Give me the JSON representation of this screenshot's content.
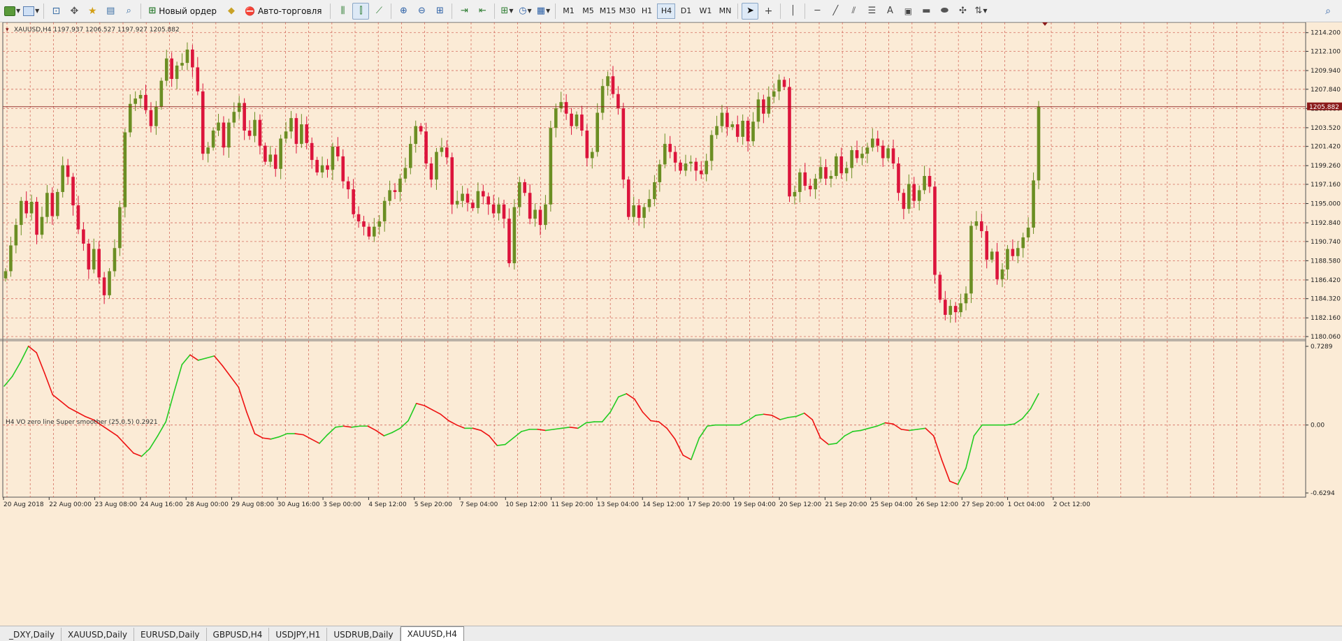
{
  "toolbar": {
    "new_order_label": "Новый ордер",
    "autotrade_label": "Авто-торговля",
    "timeframes": [
      {
        "label": "M1",
        "active": false
      },
      {
        "label": "M5",
        "active": false
      },
      {
        "label": "M15",
        "active": false
      },
      {
        "label": "M30",
        "active": false
      },
      {
        "label": "H1",
        "active": false
      },
      {
        "label": "H4",
        "active": true
      },
      {
        "label": "D1",
        "active": false
      },
      {
        "label": "W1",
        "active": false
      },
      {
        "label": "MN",
        "active": false
      }
    ]
  },
  "chart": {
    "info_line": "XAUUSD,H4  1197.937 1206.527 1197.927 1205.882",
    "current_price_label": "1205.882",
    "current_price": 1205.882,
    "indicator_label": "H4 VO zero line Super smoother (25,0.5) 0.2921",
    "price_ticks": [
      "1214.200",
      "1212.100",
      "1209.940",
      "1207.840",
      "1205.680",
      "1203.520",
      "1201.420",
      "1199.260",
      "1197.160",
      "1195.000",
      "1192.840",
      "1190.740",
      "1188.580",
      "1186.420",
      "1184.320",
      "1182.160",
      "1180.060"
    ],
    "indicator_ticks": [
      "0.7289",
      "0.00",
      "-0.6294"
    ],
    "time_labels": [
      "20 Aug 2018",
      "22 Aug 00:00",
      "23 Aug 08:00",
      "24 Aug 16:00",
      "28 Aug 00:00",
      "29 Aug 08:00",
      "30 Aug 16:00",
      "3 Sep 00:00",
      "4 Sep 12:00",
      "5 Sep 20:00",
      "7 Sep 04:00",
      "10 Sep 12:00",
      "11 Sep 20:00",
      "13 Sep 04:00",
      "14 Sep 12:00",
      "17 Sep 20:00",
      "19 Sep 04:00",
      "20 Sep 12:00",
      "21 Sep 20:00",
      "25 Sep 04:00",
      "26 Sep 12:00",
      "27 Sep 20:00",
      "1 Oct 04:00",
      "2 Oct 12:00"
    ],
    "colors": {
      "background": "#fbebd6",
      "grid": "#c8453a",
      "bull": "#6b8e23",
      "bear": "#dc143c",
      "indicator_up": "#22cc22",
      "indicator_down": "#ee1111",
      "price_tag": "#8b1a1a"
    }
  },
  "chart_data": {
    "type": "candlestick",
    "symbol": "XAUUSD",
    "timeframe": "H4",
    "ylim": [
      1180.06,
      1215.2
    ],
    "closes": [
      1187.4,
      1190.3,
      1192.6,
      1195.3,
      1193.9,
      1195.2,
      1191.5,
      1193.5,
      1196.2,
      1193.6,
      1196.3,
      1199.3,
      1198.0,
      1194.8,
      1192.1,
      1190.5,
      1187.6,
      1189.9,
      1186.7,
      1184.7,
      1187.4,
      1190.0,
      1194.6,
      1203.0,
      1206.2,
      1206.8,
      1207.2,
      1205.5,
      1203.7,
      1205.9,
      1208.8,
      1211.3,
      1209.0,
      1210.5,
      1210.8,
      1212.3,
      1210.3,
      1207.6,
      1200.6,
      1201.3,
      1203.2,
      1204.1,
      1201.3,
      1204.1,
      1205.3,
      1206.3,
      1203.2,
      1202.6,
      1204.4,
      1201.5,
      1199.7,
      1200.5,
      1198.9,
      1202.3,
      1203.1,
      1204.6,
      1201.7,
      1203.9,
      1201.8,
      1199.9,
      1198.5,
      1199.3,
      1198.8,
      1201.4,
      1200.3,
      1197.5,
      1196.6,
      1193.8,
      1193.0,
      1192.4,
      1191.3,
      1192.4,
      1193.0,
      1195.3,
      1196.5,
      1196.3,
      1197.8,
      1199.0,
      1201.7,
      1203.7,
      1203.1,
      1199.5,
      1197.7,
      1200.8,
      1201.3,
      1200.2,
      1194.9,
      1195.3,
      1196.1,
      1195.1,
      1194.5,
      1196.4,
      1195.8,
      1194.9,
      1193.9,
      1194.9,
      1193.3,
      1188.3,
      1194.6,
      1197.4,
      1196.2,
      1193.3,
      1194.3,
      1192.6,
      1194.9,
      1203.5,
      1205.7,
      1206.4,
      1205.1,
      1203.7,
      1205.0,
      1203.2,
      1200.1,
      1200.8,
      1205.2,
      1208.2,
      1209.3,
      1207.3,
      1205.7,
      1197.7,
      1193.5,
      1194.8,
      1193.4,
      1194.6,
      1195.5,
      1197.4,
      1199.4,
      1201.7,
      1200.8,
      1199.6,
      1198.7,
      1199.5,
      1199.7,
      1198.7,
      1198.3,
      1199.8,
      1202.7,
      1203.7,
      1205.2,
      1203.6,
      1203.9,
      1202.5,
      1204.3,
      1202.0,
      1204.2,
      1206.7,
      1205.1,
      1207.0,
      1207.6,
      1208.9,
      1208.1,
      1195.8,
      1196.3,
      1198.5,
      1197.0,
      1196.6,
      1197.8,
      1199.1,
      1197.8,
      1198.1,
      1200.3,
      1198.4,
      1199.0,
      1201.0,
      1200.1,
      1200.6,
      1201.3,
      1202.3,
      1201.5,
      1200.1,
      1201.2,
      1199.5,
      1196.2,
      1194.4,
      1197.2,
      1195.3,
      1196.5,
      1198.1,
      1196.9,
      1187.0,
      1184.2,
      1182.5,
      1183.5,
      1182.8,
      1183.8,
      1184.9,
      1192.5,
      1193.0,
      1191.9,
      1188.7,
      1189.6,
      1186.5,
      1187.6,
      1189.9,
      1189.1,
      1190.0,
      1191.2,
      1192.3,
      1197.6,
      1205.9
    ],
    "indicator": {
      "name": "VO zero line Super smoother",
      "params": "(25,0.5)",
      "last_value": 0.2921,
      "ylim": [
        -0.6294,
        0.7289
      ],
      "values": [
        0.36,
        0.45,
        0.58,
        0.73,
        0.67,
        0.48,
        0.28,
        0.22,
        0.16,
        0.12,
        0.08,
        0.05,
        0.0,
        -0.05,
        -0.1,
        -0.18,
        -0.26,
        -0.29,
        -0.22,
        -0.1,
        0.03,
        0.3,
        0.56,
        0.65,
        0.6,
        0.62,
        0.64,
        0.55,
        0.45,
        0.35,
        0.12,
        -0.08,
        -0.12,
        -0.13,
        -0.11,
        -0.08,
        -0.08,
        -0.09,
        -0.13,
        -0.17,
        -0.09,
        -0.02,
        -0.01,
        -0.02,
        -0.01,
        -0.01,
        -0.05,
        -0.1,
        -0.07,
        -0.03,
        0.04,
        0.2,
        0.18,
        0.14,
        0.1,
        0.04,
        0.0,
        -0.03,
        -0.03,
        -0.05,
        -0.1,
        -0.19,
        -0.18,
        -0.12,
        -0.06,
        -0.04,
        -0.04,
        -0.05,
        -0.04,
        -0.03,
        -0.02,
        -0.03,
        0.02,
        0.03,
        0.03,
        0.12,
        0.26,
        0.29,
        0.24,
        0.12,
        0.04,
        0.03,
        -0.03,
        -0.13,
        -0.28,
        -0.32,
        -0.12,
        -0.01,
        0.0,
        0.0,
        0.0,
        0.0,
        0.04,
        0.09,
        0.1,
        0.09,
        0.05,
        0.07,
        0.08,
        0.11,
        0.05,
        -0.12,
        -0.18,
        -0.17,
        -0.1,
        -0.06,
        -0.05,
        -0.03,
        -0.01,
        0.02,
        0.01,
        -0.04,
        -0.05,
        -0.04,
        -0.03,
        -0.1,
        -0.32,
        -0.52,
        -0.55,
        -0.4,
        -0.1,
        0.0,
        0.0,
        0.0,
        0.0,
        0.01,
        0.06,
        0.15,
        0.29
      ]
    }
  }
}
